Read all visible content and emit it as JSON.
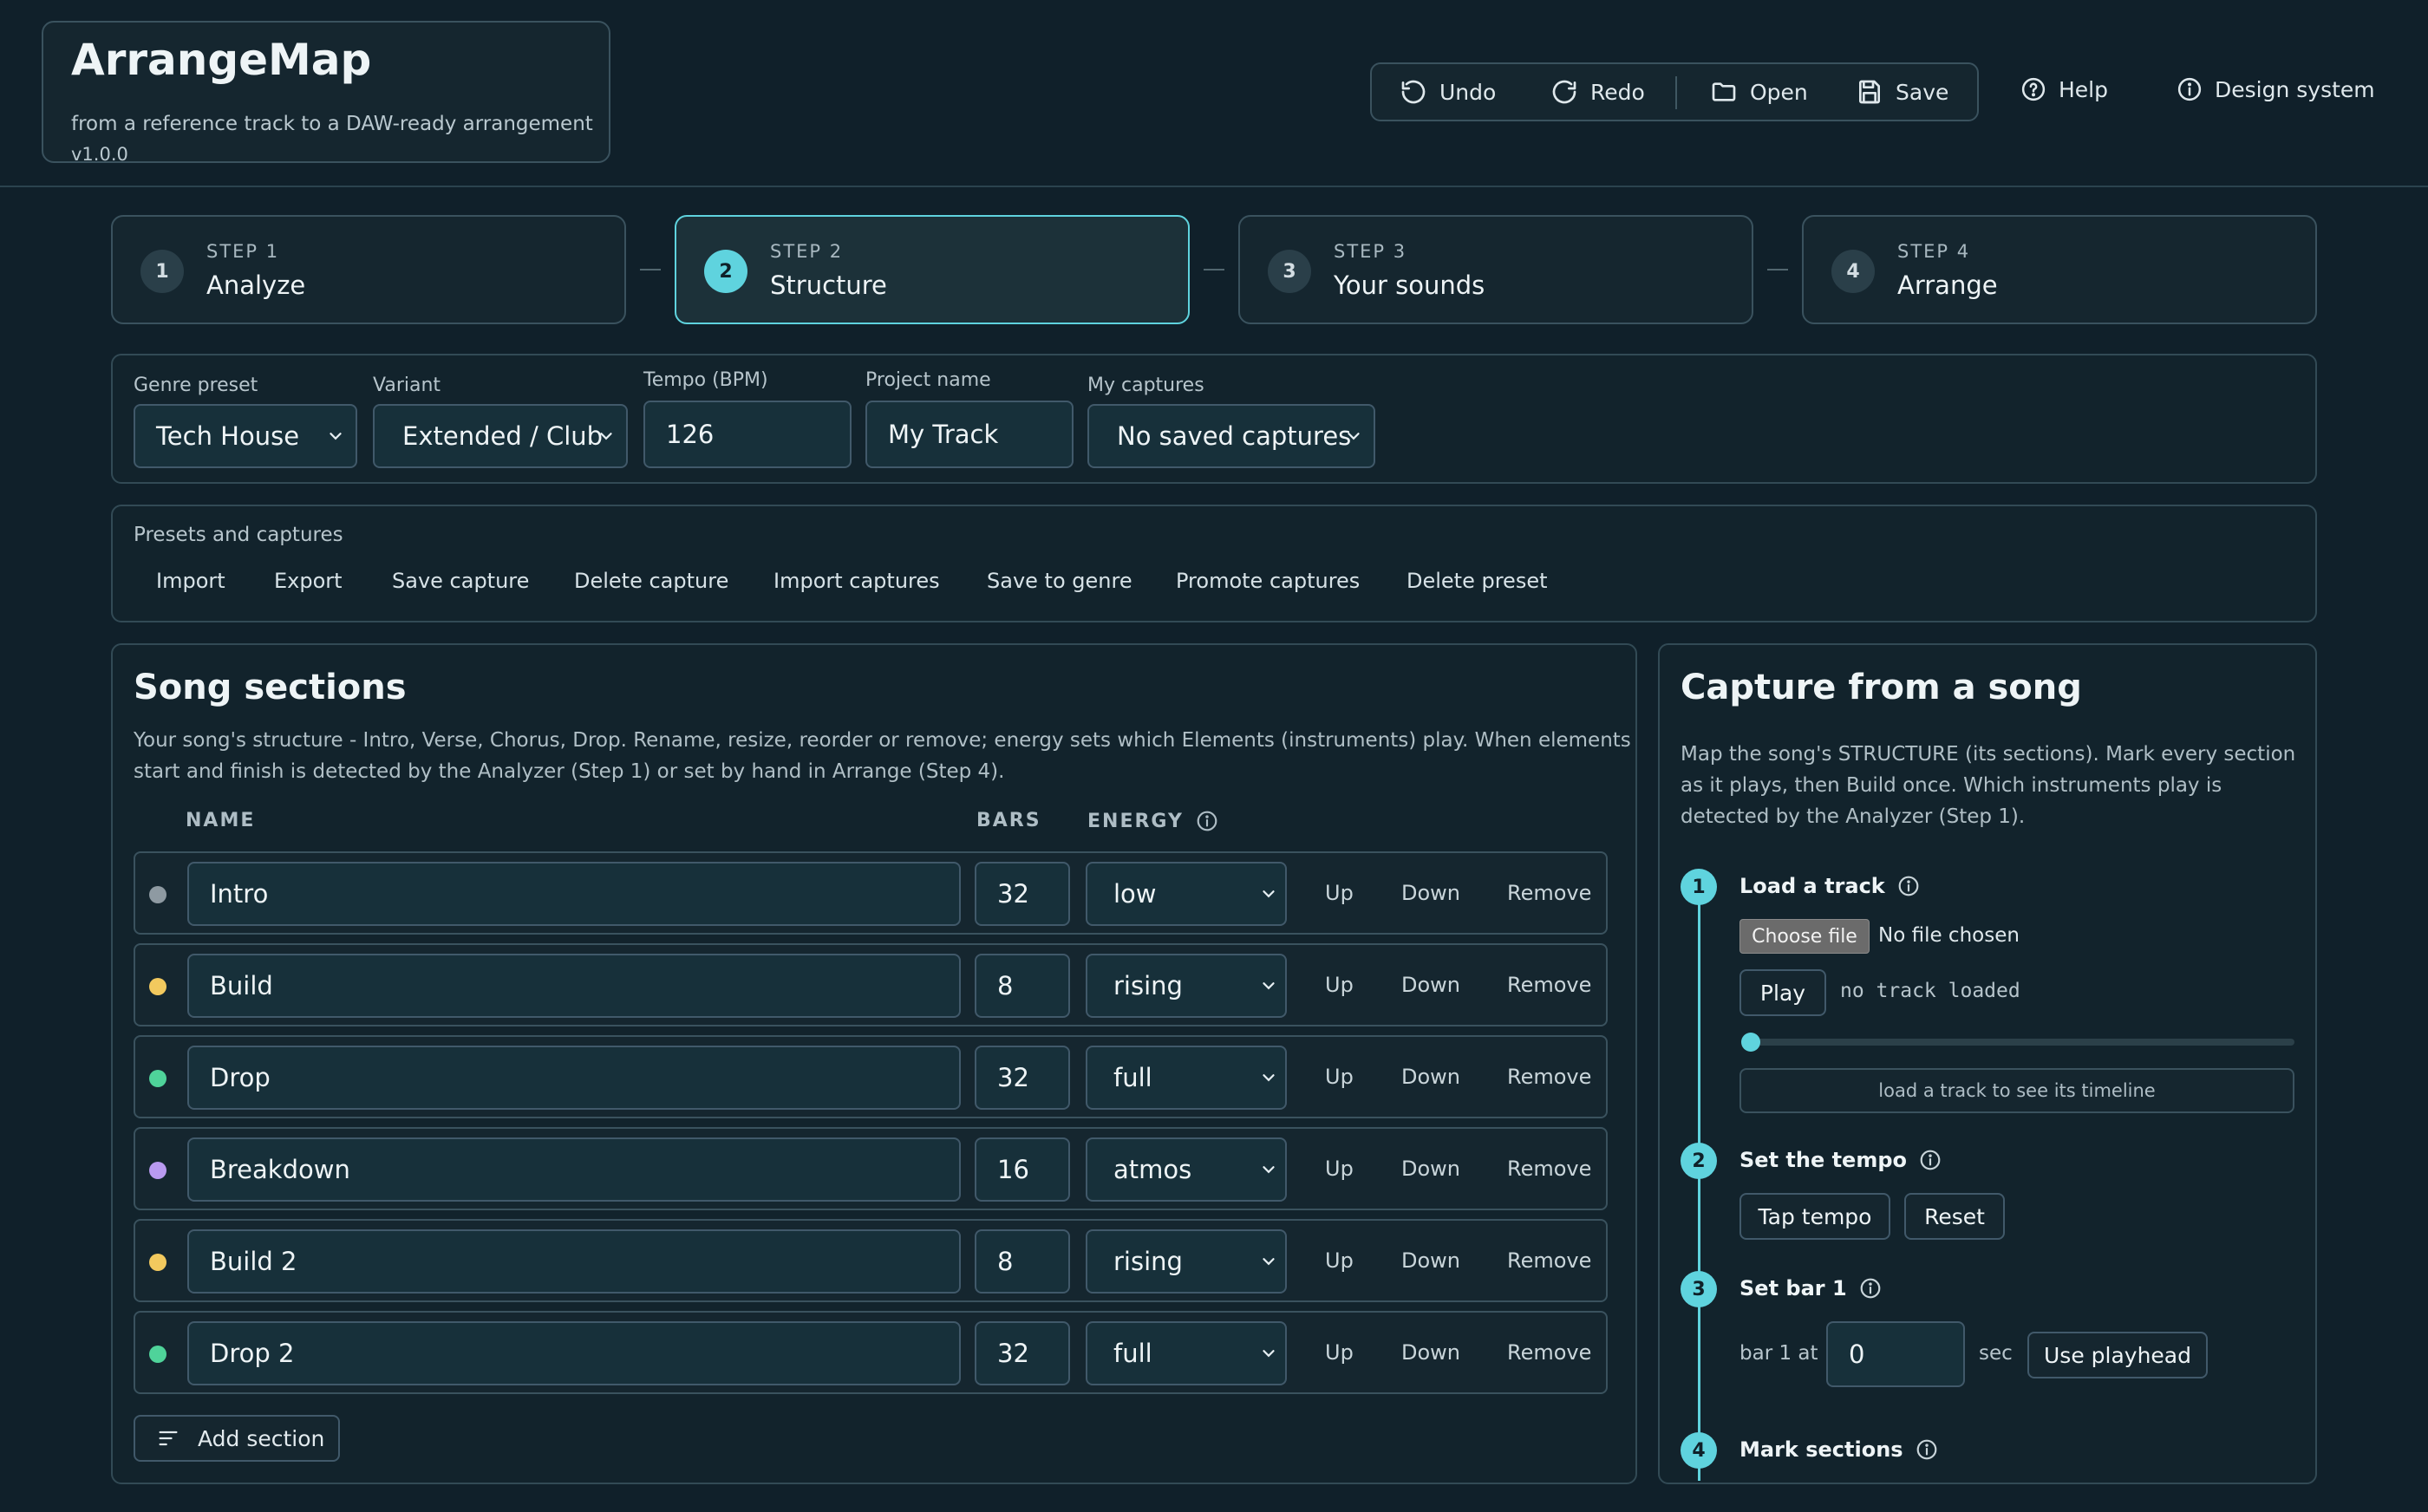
{
  "app": {
    "title": "ArrangeMap",
    "subtitle": "from a reference track to a DAW-ready arrangement",
    "version": "v1.0.0"
  },
  "toolbar": {
    "undo": "Undo",
    "redo": "Redo",
    "open": "Open",
    "save": "Save",
    "help": "Help",
    "design_system": "Design system"
  },
  "steps": [
    {
      "num": "1",
      "kicker": "STEP 1",
      "title": "Analyze"
    },
    {
      "num": "2",
      "kicker": "STEP 2",
      "title": "Structure"
    },
    {
      "num": "3",
      "kicker": "STEP 3",
      "title": "Your sounds"
    },
    {
      "num": "4",
      "kicker": "STEP 4",
      "title": "Arrange"
    }
  ],
  "form": {
    "genre_label": "Genre preset",
    "genre_value": "Tech House",
    "variant_label": "Variant",
    "variant_value": "Extended / Club",
    "tempo_label": "Tempo (BPM)",
    "tempo_value": "126",
    "project_label": "Project name",
    "project_value": "My Track",
    "captures_label": "My captures",
    "captures_value": "No saved captures"
  },
  "presets": {
    "title": "Presets and captures",
    "actions": [
      "Import",
      "Export",
      "Save capture",
      "Delete capture",
      "Import captures",
      "Save to genre",
      "Promote captures",
      "Delete preset"
    ]
  },
  "sections": {
    "title": "Song sections",
    "description_1": "Your song's structure - Intro, Verse, Chorus, Drop. Rename, resize, reorder or remove; energy sets which Elements (instruments) play. When elements",
    "description_2": "start and finish is detected by the Analyzer (Step 1) or set by hand in Arrange (Step 4).",
    "col_name": "NAME",
    "col_bars": "BARS",
    "col_energy": "ENERGY",
    "action_up": "Up",
    "action_down": "Down",
    "action_remove": "Remove",
    "add_label": "Add section",
    "rows": [
      {
        "name": "Intro",
        "bars": "32",
        "energy": "low",
        "color": "#8e9aa2"
      },
      {
        "name": "Build",
        "bars": "8",
        "energy": "rising",
        "color": "#f2c95e"
      },
      {
        "name": "Drop",
        "bars": "32",
        "energy": "full",
        "color": "#4fd39a"
      },
      {
        "name": "Breakdown",
        "bars": "16",
        "energy": "atmos",
        "color": "#b99af0"
      },
      {
        "name": "Build 2",
        "bars": "8",
        "energy": "rising",
        "color": "#f2c95e"
      },
      {
        "name": "Drop 2",
        "bars": "32",
        "energy": "full",
        "color": "#4fd39a"
      }
    ]
  },
  "capture": {
    "title": "Capture from a song",
    "desc_1": "Map the song's STRUCTURE (its sections). Mark every section",
    "desc_2": "as it plays, then Build once. Which instruments play is",
    "desc_3": "detected by the Analyzer (Step 1).",
    "step1_num": "1",
    "step1_title": "Load a track",
    "choose_file": "Choose file",
    "no_file": "No file chosen",
    "play": "Play",
    "no_track": "no track loaded",
    "timeline_hint": "load a track to see its timeline",
    "step2_num": "2",
    "step2_title": "Set the tempo",
    "tap_tempo": "Tap tempo",
    "reset": "Reset",
    "step3_num": "3",
    "step3_title": "Set bar 1",
    "bar1_prefix": "bar 1 at",
    "bar1_value": "0",
    "bar1_unit": "sec",
    "use_playhead": "Use playhead",
    "step4_num": "4",
    "step4_title": "Mark sections"
  },
  "colors": {
    "accent": "#5fd3de",
    "background": "#10202a",
    "panel": "#15262f"
  }
}
